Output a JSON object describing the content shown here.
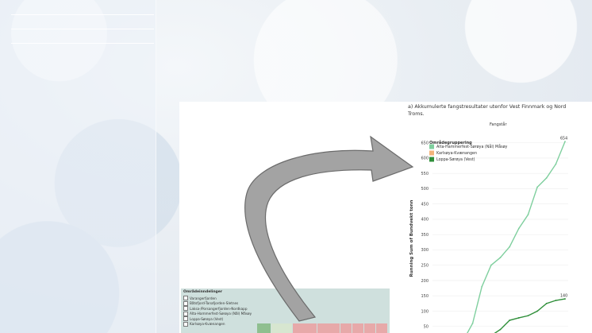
{
  "chart_title": "a) Akkumulerte fangstresultater utenfor Vest Finnmark og Nord Troms.",
  "subtitle": "Fangstår",
  "legend": {
    "title": "Områdegruppering",
    "items": [
      {
        "label": "Alta-Hammerfest-Sørøya (Nål) Måsøy",
        "color": "#7fcf9e"
      },
      {
        "label": "Karlsøya-Kvænangen",
        "color": "#f3b37a"
      },
      {
        "label": "Loppa-Sørøya (Vest)",
        "color": "#2f8f3a"
      }
    ]
  },
  "y_axis_label": "Running Sum of Bundvekt tonn",
  "filter_panel": {
    "title": "Områdeinndelinger",
    "items": [
      "Varangerfjorden",
      "Båtsfjord-Tanafjorden-Sletnes",
      "Laksa-/Porsangerfjorden-Nordkapp",
      "Alta-Hammerfest-Sørøya (Nål) Måsøy",
      "Loppa-Sørøya (Vest)",
      "Karlsøya-Kvænangen"
    ]
  },
  "chart_data": {
    "type": "line",
    "ylim": [
      0,
      675
    ],
    "yticks": [
      50,
      100,
      150,
      200,
      250,
      300,
      350,
      400,
      450,
      500,
      550,
      600,
      650
    ],
    "series": [
      {
        "name": "Alta-Hammerfest-Sørøya (Nål) Måsøy",
        "color": "#7fcf9e",
        "values": [
          0,
          0,
          0,
          5,
          60,
          180,
          250,
          275,
          310,
          370,
          415,
          505,
          535,
          580,
          654
        ],
        "end_label": "654"
      },
      {
        "name": "Loppa-Sørøya (Vest)",
        "color": "#2f8f3a",
        "values": [
          0,
          0,
          0,
          0,
          0,
          0,
          20,
          40,
          70,
          78,
          85,
          100,
          125,
          135,
          140
        ],
        "end_label": "140"
      }
    ]
  }
}
